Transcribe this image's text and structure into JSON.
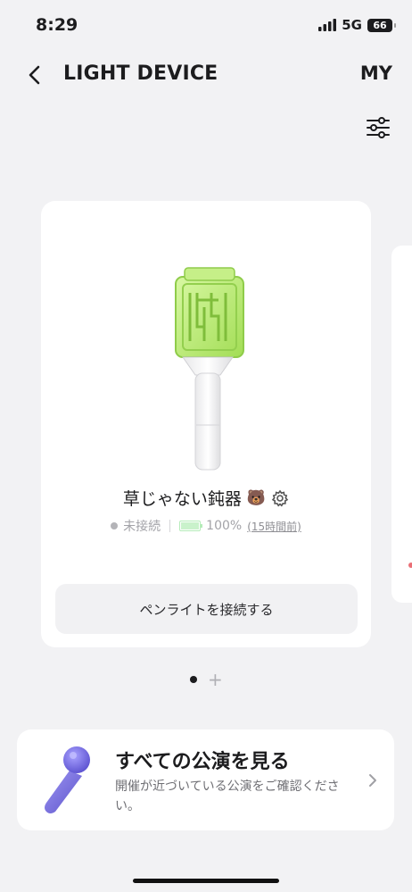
{
  "status_bar": {
    "time": "8:29",
    "network": "5G",
    "battery": "66"
  },
  "header": {
    "title": "LIGHT DEVICE",
    "my_label": "MY"
  },
  "device_card": {
    "name": "草じゃない鈍器",
    "emoji": "🐻",
    "connection_status": "未接続",
    "battery_percent": "100%",
    "last_seen": "(15時間前)",
    "connect_button": "ペンライトを接続する"
  },
  "pager": {
    "pages": 1,
    "current": 0,
    "add_symbol": "+"
  },
  "promo": {
    "title": "すべての公演を見る",
    "description": "開催が近づいている公演をご確認ください。"
  },
  "colors": {
    "background": "#f2f2f4",
    "card": "#ffffff",
    "lightstick_green": "#b8ea79",
    "accent_pink": "#ea6f76",
    "mic_purple": "#7d74e0"
  },
  "icons": [
    "signal-icon",
    "battery-icon",
    "back-chevron-icon",
    "filter-sliders-icon",
    "settings-gear-icon",
    "battery-full-icon",
    "microphone-icon",
    "chevron-right-icon"
  ]
}
